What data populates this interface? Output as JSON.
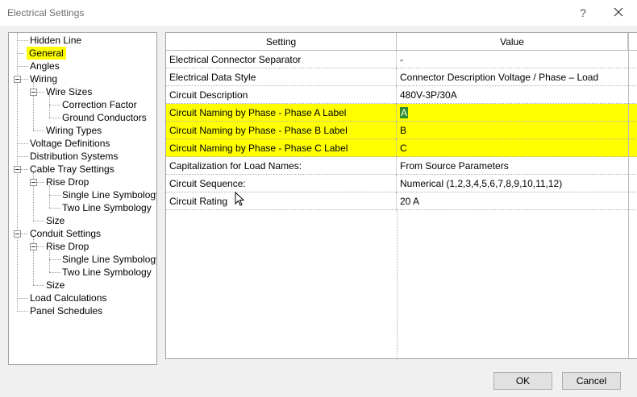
{
  "window": {
    "title": "Electrical Settings"
  },
  "tree": {
    "items": [
      {
        "label": "Hidden Line"
      },
      {
        "label": "General"
      },
      {
        "label": "Angles"
      },
      {
        "label": "Wiring"
      },
      {
        "label": "Wire Sizes"
      },
      {
        "label": "Correction Factor"
      },
      {
        "label": "Ground Conductors"
      },
      {
        "label": "Wiring Types"
      },
      {
        "label": "Voltage Definitions"
      },
      {
        "label": "Distribution Systems"
      },
      {
        "label": "Cable Tray Settings"
      },
      {
        "label": "Rise Drop"
      },
      {
        "label": "Single Line Symbology"
      },
      {
        "label": "Two Line Symbology"
      },
      {
        "label": "Size"
      },
      {
        "label": "Conduit Settings"
      },
      {
        "label": "Rise Drop"
      },
      {
        "label": "Single Line Symbology"
      },
      {
        "label": "Two Line Symbology"
      },
      {
        "label": "Size"
      },
      {
        "label": "Load Calculations"
      },
      {
        "label": "Panel Schedules"
      }
    ],
    "selected": "General"
  },
  "grid": {
    "columns": [
      "Setting",
      "Value"
    ],
    "rows": [
      {
        "setting": "Electrical Connector Separator",
        "value": "-"
      },
      {
        "setting": "Electrical Data Style",
        "value": "Connector Description Voltage / Phase – Load"
      },
      {
        "setting": "Circuit Description",
        "value": "480V-3P/30A"
      },
      {
        "setting": "Circuit Naming by Phase - Phase A Label",
        "value": "A"
      },
      {
        "setting": "Circuit Naming by Phase - Phase B Label",
        "value": "B"
      },
      {
        "setting": "Circuit Naming by Phase - Phase C Label",
        "value": "C"
      },
      {
        "setting": "Capitalization for Load Names:",
        "value": "From Source Parameters"
      },
      {
        "setting": "Circuit Sequence:",
        "value": "Numerical (1,2,3,4,5,6,7,8,9,10,11,12)"
      },
      {
        "setting": "Circuit Rating",
        "value": "20 A"
      }
    ]
  },
  "buttons": {
    "ok": "OK",
    "cancel": "Cancel"
  },
  "colors": {
    "highlight": "#ffff00",
    "selection": "#2e8b2e"
  }
}
